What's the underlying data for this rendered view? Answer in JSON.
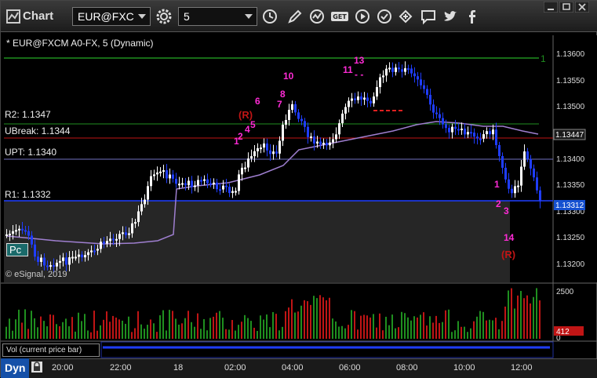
{
  "app": {
    "title": "Chart"
  },
  "toolbar": {
    "symbol": "EUR@FXC",
    "interval": "5"
  },
  "chart": {
    "header": "* EUR@FXCM A0-FX, 5 (Dynamic)",
    "watermark": "© eSignal, 2019",
    "level_labels": [
      {
        "text": "R2: 1.1347"
      },
      {
        "text": "UBreak: 1.1344"
      },
      {
        "text": "UPT: 1.1340"
      },
      {
        "text": "R1: 1.1332"
      }
    ],
    "pc_label": "Pc",
    "price_ticks": [
      "1.13600",
      "1.13550",
      "1.13500",
      "1.13400",
      "1.13350",
      "1.13300",
      "1.13250",
      "1.13200"
    ],
    "price_markers": [
      {
        "value": "1.13447",
        "color": "#1a1a1a"
      },
      {
        "value": "1.13312",
        "color": "#1550d0"
      }
    ],
    "time_ticks": [
      "20:00",
      "22:00",
      "18",
      "02:00",
      "04:00",
      "06:00",
      "08:00",
      "10:00",
      "12:00"
    ],
    "annotations": [
      "1",
      "2",
      "4",
      "5",
      "6",
      "7",
      "8",
      "10",
      "11",
      "13",
      "(R)",
      "(R)",
      "1",
      "2",
      "3",
      "14"
    ],
    "colors": {
      "bull": "#ffffff",
      "bear": "#1f3dff",
      "green_line": "#1f8f1f",
      "red_line": "#c01515",
      "magenta": "#ff2bd6",
      "ma": "#9f7fd0"
    }
  },
  "volume": {
    "label": "Vol (current price bar)",
    "ticks": [
      "2500",
      "0"
    ],
    "marker": "412"
  },
  "status": {
    "mode": "Dyn"
  }
}
